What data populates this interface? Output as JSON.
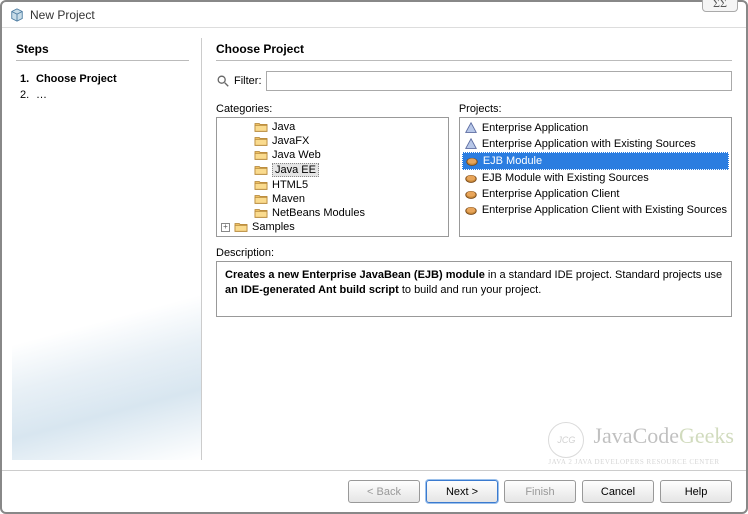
{
  "window": {
    "title": "New Project",
    "close_glyph": "ΣΣ"
  },
  "steps": {
    "heading": "Steps",
    "items": [
      {
        "num": "1.",
        "label": "Choose Project",
        "current": true
      },
      {
        "num": "2.",
        "label": "…",
        "current": false
      }
    ]
  },
  "main": {
    "heading": "Choose Project",
    "filter_label": "Filter:",
    "filter_value": "",
    "categories_label": "Categories:",
    "projects_label": "Projects:",
    "description_label": "Description:",
    "description_html": "<b>Creates a new Enterprise JavaBean (EJB) module</b> in a standard IDE project. Standard projects use <b>an IDE-generated Ant build script</b> to build and run your project."
  },
  "categories": [
    {
      "label": "Java",
      "expandable": false,
      "selected": false,
      "indent": 1
    },
    {
      "label": "JavaFX",
      "expandable": false,
      "selected": false,
      "indent": 1
    },
    {
      "label": "Java Web",
      "expandable": false,
      "selected": false,
      "indent": 1
    },
    {
      "label": "Java EE",
      "expandable": false,
      "selected": true,
      "indent": 1
    },
    {
      "label": "HTML5",
      "expandable": false,
      "selected": false,
      "indent": 1
    },
    {
      "label": "Maven",
      "expandable": false,
      "selected": false,
      "indent": 1
    },
    {
      "label": "NetBeans Modules",
      "expandable": false,
      "selected": false,
      "indent": 1
    },
    {
      "label": "Samples",
      "expandable": true,
      "selected": false,
      "indent": 0
    }
  ],
  "projects": [
    {
      "label": "Enterprise Application",
      "icon": "triangle",
      "selected": false
    },
    {
      "label": "Enterprise Application with Existing Sources",
      "icon": "triangle",
      "selected": false
    },
    {
      "label": "EJB Module",
      "icon": "bean",
      "selected": true
    },
    {
      "label": "EJB Module with Existing Sources",
      "icon": "bean",
      "selected": false
    },
    {
      "label": "Enterprise Application Client",
      "icon": "bean",
      "selected": false
    },
    {
      "label": "Enterprise Application Client with Existing Sources",
      "icon": "bean",
      "selected": false
    }
  ],
  "buttons": {
    "back": "< Back",
    "next": "Next >",
    "finish": "Finish",
    "cancel": "Cancel",
    "help": "Help"
  },
  "watermark": {
    "circle": "JCG",
    "main_a": "Java",
    "main_b": "Code",
    "main_c": "Geeks",
    "sub": "JAVA 2 JAVA DEVELOPERS RESOURCE CENTER"
  }
}
